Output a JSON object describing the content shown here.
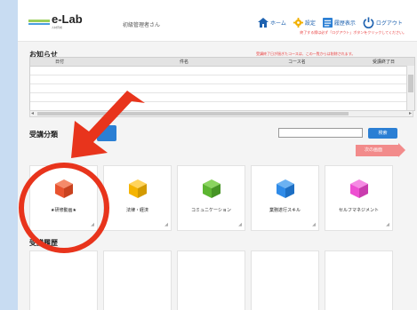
{
  "header": {
    "logo_text": "e-Lab",
    "logo_subtext": "人材育成",
    "user_name": "初級管理者さん",
    "nav": [
      {
        "icon": "home-icon",
        "label": "ホーム"
      },
      {
        "icon": "gear-icon",
        "label": "設定"
      },
      {
        "icon": "history-icon",
        "label": "履歴表示"
      },
      {
        "icon": "power-icon",
        "label": "ログアウト"
      }
    ],
    "hint": "終了する際は必ず「ログアウト」ボタンをクリックしてください。"
  },
  "notice": {
    "title": "お知らせ",
    "note": "受講終了日が過ぎたコースは、この一覧からは削除されます。",
    "columns": [
      "日付",
      "件名",
      "コース名",
      "受講終了日"
    ]
  },
  "categories": {
    "title": "受講分類",
    "search_label": "検索",
    "next_label": "次の画面",
    "items": [
      {
        "label": "★研修動画★",
        "color": "#e8532f"
      },
      {
        "label": "法律・経済",
        "color": "#f5b400"
      },
      {
        "label": "コミュニケーション",
        "color": "#5cb531"
      },
      {
        "label": "業務遂行スキル",
        "color": "#2f8be8"
      },
      {
        "label": "セルフマネジメント",
        "color": "#ee4fd2"
      }
    ]
  },
  "history": {
    "title": "受講履歴"
  },
  "colors": {
    "annotation": "#e8341c",
    "accent": "#2b7fd4"
  }
}
